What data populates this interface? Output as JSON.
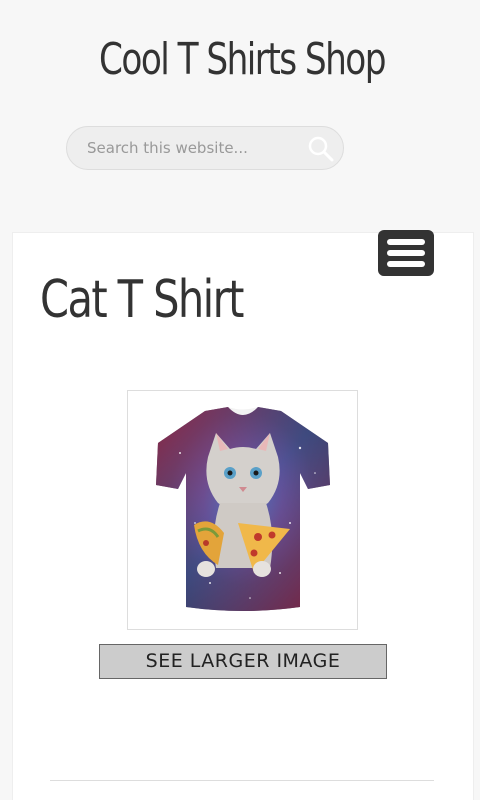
{
  "header": {
    "site_title": "Cool T Shirts Shop"
  },
  "search": {
    "placeholder": "Search this website...",
    "value": ""
  },
  "menu": {
    "icon": "hamburger-menu-icon"
  },
  "main": {
    "page_title": "Cat T Shirt",
    "product_image": {
      "alt": "Cat T Shirt"
    },
    "larger_image_button": "SEE LARGER IMAGE"
  },
  "colors": {
    "background": "#f7f7f7",
    "text": "#333333",
    "menu_button": "#333333",
    "button_bg": "#cccccc"
  }
}
